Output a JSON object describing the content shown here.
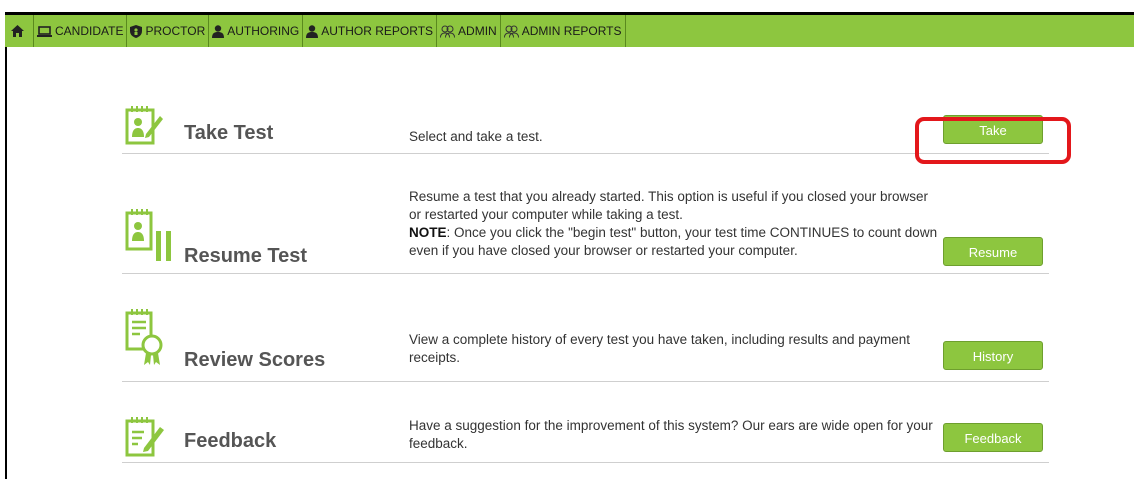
{
  "nav": {
    "items": [
      {
        "label": "CANDIDATE",
        "icon": "laptop-icon"
      },
      {
        "label": "PROCTOR",
        "icon": "shield-icon"
      },
      {
        "label": "AUTHORING",
        "icon": "user-icon"
      },
      {
        "label": "AUTHOR REPORTS",
        "icon": "user-icon"
      },
      {
        "label": "ADMIN",
        "icon": "users-icon"
      },
      {
        "label": "ADMIN REPORTS",
        "icon": "users-icon"
      }
    ]
  },
  "rows": [
    {
      "title": "Take Test",
      "desc": "Select and take a test.",
      "button": "Take",
      "icon": "take-test-icon"
    },
    {
      "title": "Resume Test",
      "desc": "Resume a test that you already started. This option is useful if you closed your browser or restarted your computer while taking a test.",
      "note_label": "NOTE",
      "note_text": ": Once you click the \"begin test\" button, your test time CONTINUES to count down even if you have closed your browser or restarted your computer.",
      "button": "Resume",
      "icon": "resume-test-icon"
    },
    {
      "title": "Review Scores",
      "desc": "View a complete history of every test you have taken, including results and payment receipts.",
      "button": "History",
      "icon": "review-scores-icon"
    },
    {
      "title": "Feedback",
      "desc": "Have a suggestion for the improvement of this system? Our ears are wide open for your feedback.",
      "button": "Feedback",
      "icon": "feedback-icon"
    }
  ],
  "colors": {
    "accent": "#8dc63f",
    "highlight": "#e3171b"
  }
}
